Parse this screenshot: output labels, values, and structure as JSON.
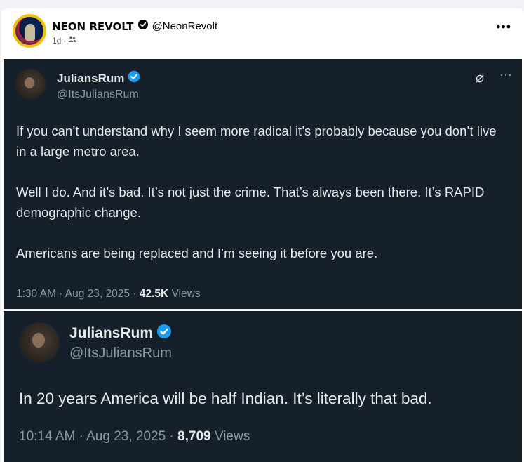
{
  "post": {
    "page_name": "NEON REVOLT",
    "handle": "@NeonRevolt",
    "time": "1d",
    "audience_icon": "friends-icon",
    "more_label": "•••"
  },
  "tweets": [
    {
      "name": "JuliansRum",
      "handle": "@ItsJuliansRum",
      "paragraphs": [
        "If you can’t understand why I seem more radical it’s probably because you don’t live in a large metro area.",
        "Well I do. And it’s bad. It’s not just the crime. That’s always been there. It’s RAPID demographic change.",
        "Americans are being replaced and I’m seeing it before you are."
      ],
      "timestamp": "1:30 AM · Aug 23, 2025 · ",
      "views_count": "42.5K",
      "views_label": " Views",
      "grok_icon": "⌀",
      "more_label": "···"
    },
    {
      "name": "JuliansRum",
      "handle": "@ItsJuliansRum",
      "text": "In 20 years America will be half Indian. It’s literally that bad.",
      "timestamp": "10:14 AM · Aug 23, 2025 · ",
      "views_count": "8,709",
      "views_label": " Views"
    }
  ],
  "colors": {
    "tweet_bg": "#15202b",
    "verified_blue": "#1d9bf0",
    "text_primary": "#e7e9ea",
    "text_secondary": "#8b98a5"
  }
}
